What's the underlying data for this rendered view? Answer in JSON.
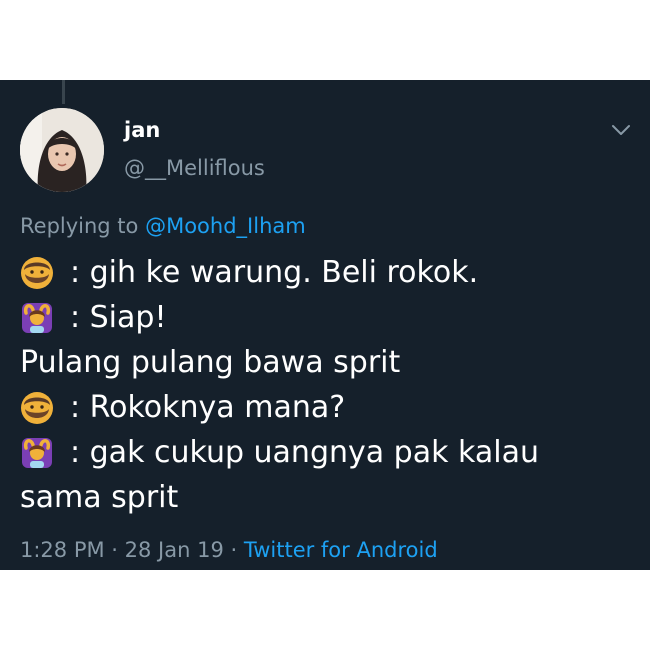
{
  "tweet": {
    "display_name": "jan",
    "handle": "@__Melliflous",
    "replying_prefix": "Replying to",
    "replying_to": "@Moohd_Ilham",
    "lines": [
      {
        "icon": "man-beard-emoji",
        "text": ": gih ke warung. Beli rokok."
      },
      {
        "icon": "woman-gesturing-ok-emoji",
        "text": ": Siap!"
      },
      {
        "icon": "",
        "text": "Pulang pulang bawa sprit"
      },
      {
        "icon": "man-beard-emoji",
        "text": ": Rokoknya mana?"
      },
      {
        "icon": "woman-gesturing-ok-emoji",
        "text": ": gak cukup uangnya pak kalau"
      },
      {
        "icon": "",
        "text": "sama sprit"
      }
    ],
    "time": "1:28 PM",
    "separator": " · ",
    "date": "28 Jan 19",
    "source": "Twitter for Android",
    "more_icon": "chevron-down-icon"
  },
  "colors": {
    "background": "#15202b",
    "text": "#ffffff",
    "muted": "#8899a6",
    "link": "#1da1f2"
  }
}
